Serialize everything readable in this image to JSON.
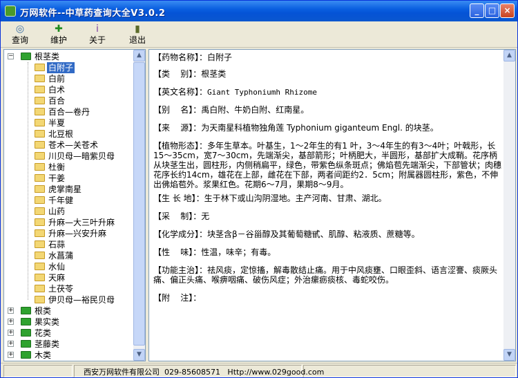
{
  "window": {
    "title": "万网软件--中草药查询大全V3.0.2"
  },
  "toolbar": [
    {
      "label": "查询",
      "icon": "query-icon",
      "glyph": "◎"
    },
    {
      "label": "维护",
      "icon": "add-icon",
      "glyph": "✚"
    },
    {
      "label": "关于",
      "icon": "about-icon",
      "glyph": "ⅰ"
    },
    {
      "label": "退出",
      "icon": "exit-icon",
      "glyph": "▮"
    }
  ],
  "tree": {
    "root_open": "根茎类",
    "children": [
      "白附子",
      "白前",
      "白术",
      "百合",
      "百合—卷丹",
      "半夏",
      "北豆根",
      "苍术—关苍术",
      "川贝母—暗紫贝母",
      "杜衡",
      "干姜",
      "虎掌南星",
      "千年健",
      "山药",
      "升麻—大三叶升麻",
      "升麻—兴安升麻",
      "石蒜",
      "水菖蒲",
      "水仙",
      "天麻",
      "土茯苓",
      "伊贝母—裕民贝母"
    ],
    "selected": "白附子",
    "other_roots": [
      "根类",
      "果实类",
      "花类",
      "茎藤类",
      "木类"
    ]
  },
  "detail": [
    {
      "label": "【药物名称】：",
      "value": "白附子"
    },
    {
      "label": "【类    别】：",
      "value": "根茎类"
    },
    {
      "label": "【英文名称】：",
      "value": "Giant Typhoniumh Rhizome",
      "mono": true
    },
    {
      "label": "【别    名】：",
      "value": "禹白附、牛奶白附、红南星。"
    },
    {
      "label": "【来    源】：",
      "value": "为天南星科植物独角莲 Typhonium giganteum Engl. 的块茎。"
    },
    {
      "label": "【植物形态】：",
      "value": "多年生草本。叶基生，1～2年生的有1 叶，3～4年生的有3～4叶；叶戟形，长15～35cm，宽7～30cm，先端渐尖，基部箭形；叶柄肥大，半圆形，基部扩大成鞘。花序柄从块茎生出，圆柱形，内侧稍扁平，绿色，带紫色纵条斑点；佛焰苞先端渐尖，下部管状；肉穗花序长约14cm，雄花在上部，雌花在下部，两者间距约2．5cm；附属器圆柱形，紫色，不伸出佛焰苞外。浆果红色。花期6～7月，果期8～9月。"
    },
    {
      "label": "【生 长 地】：",
      "value": "生于林下或山沟阴湿地。主产河南、甘肃、湖北。"
    },
    {
      "label": "【采    制】：",
      "value": "无"
    },
    {
      "label": "【化学成分】：",
      "value": "块茎含β－谷甾醇及其葡萄糖甙、肌醇、粘液质、蔗糖等。"
    },
    {
      "label": "【性    味】：",
      "value": "性温，味辛；有毒。"
    },
    {
      "label": "【功能主治】：",
      "value": "祛风痰，定惊搐，解毒散结止痛。用于中风痰壅、口眼歪斜、语言涩謇、痰厥头痛、偏正头痛、喉痹咽痛、破伤风症；外治瘰疬痰核、毒蛇咬伤。"
    },
    {
      "label": "【附    注】：",
      "value": ""
    }
  ],
  "status": {
    "text": "西安万网软件有限公司  029-85608571   Http://www.029good.com"
  },
  "colors": {
    "titlebar": "#0a5fe0",
    "selection": "#316ac5",
    "window_bg": "#ece9d8"
  }
}
